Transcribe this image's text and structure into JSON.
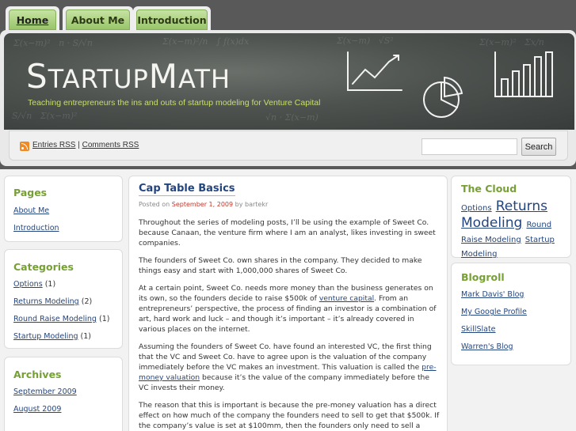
{
  "nav": {
    "tabs": [
      {
        "label": "Home"
      },
      {
        "label": "About Me"
      },
      {
        "label": "Introduction"
      }
    ]
  },
  "header": {
    "logo_part1": "S",
    "logo_part2": "TARTUP",
    "logo_part3": "M",
    "logo_part4": "ATH",
    "tagline": "Teaching entrepreneurs the ins and outs of startup modeling for Venture Capital"
  },
  "rss": {
    "entries_label": "Entries RSS",
    "separator": "|",
    "comments_label": "Comments RSS"
  },
  "search": {
    "placeholder": "",
    "button_label": "Search"
  },
  "left_sidebar": {
    "pages": {
      "title": "Pages",
      "items": [
        {
          "label": "About Me"
        },
        {
          "label": "Introduction"
        }
      ]
    },
    "categories": {
      "title": "Categories",
      "items": [
        {
          "label": "Options",
          "count": "(1)"
        },
        {
          "label": "Returns Modeling",
          "count": "(2)"
        },
        {
          "label": "Round Raise Modeling",
          "count": "(1)"
        },
        {
          "label": "Startup Modeling",
          "count": "(1)"
        }
      ]
    },
    "archives": {
      "title": "Archives",
      "items": [
        {
          "label": "September 2009"
        },
        {
          "label": "August 2009"
        }
      ]
    }
  },
  "post": {
    "title": "Cap Table Basics",
    "posted_on": "Posted on",
    "date": "September 1, 2009",
    "by": "by",
    "author": "bartekr",
    "paragraphs": {
      "p1": "Throughout the series of modeling posts, I’ll be using the example of Sweet Co. because Canaan, the venture firm where I am an analyst, likes investing in sweet companies.",
      "p2": "The founders of Sweet Co. own shares in the company.  They decided to make things easy and start with 1,000,000 shares of Sweet Co.",
      "p3_a": "At a certain point, Sweet Co. needs more money than the business generates on its own, so the founders decide to raise $500k of ",
      "p3_link": "venture capital",
      "p3_b": ".  From an entrepreneurs’ perspective, the process of finding an investor is a combination of art, hard work and luck – and though it’s important – it’s already covered in various places on the internet.",
      "p4_a": "Assuming the founders of Sweet Co. have found an interested VC, the first thing that the VC and Sweet Co. have to agree upon is the valuation of the company immediately before the VC makes an investment.  This valuation is called the ",
      "p4_link": "pre-money valuation",
      "p4_b": " because it’s the value of the company immediately before the VC invests their money.",
      "p5": "The reason that this is important is because the pre-money valuation has a direct effect on how much of the company the founders need to sell to get that $500k.  If the company’s value is set at $100mm, then the founders only need to sell a small part of"
    }
  },
  "right_sidebar": {
    "cloud": {
      "title": "The Cloud",
      "tags": [
        {
          "label": "Options"
        },
        {
          "label": "Returns Modeling"
        },
        {
          "label": "Round"
        },
        {
          "label": "Raise Modeling"
        },
        {
          "label": "Startup Modeling"
        }
      ]
    },
    "blogroll": {
      "title": "Blogroll",
      "items": [
        {
          "label": "Mark Davis' Blog"
        },
        {
          "label": "My Google Profile"
        },
        {
          "label": "SkillSlate"
        },
        {
          "label": "Warren's Blog"
        }
      ]
    }
  },
  "colors": {
    "accent_green": "#76a035",
    "link_blue": "#23457f",
    "date_red": "#c0392b",
    "tagline_green": "#c9de6f"
  }
}
